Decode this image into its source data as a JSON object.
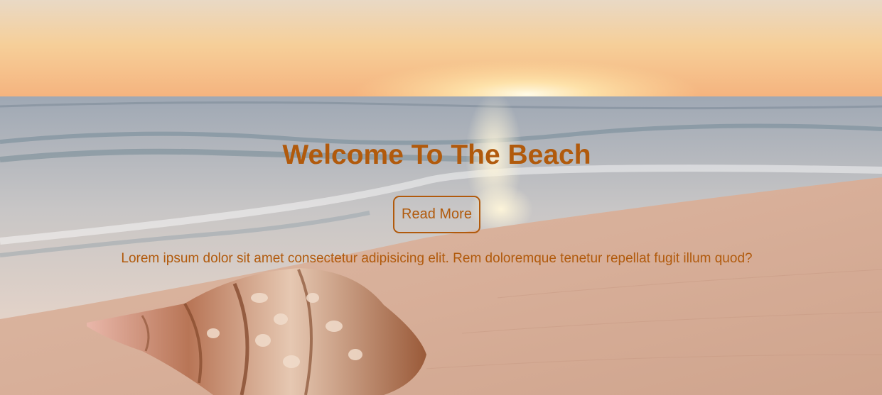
{
  "hero": {
    "title": "Welcome To The Beach",
    "button_label": "Read More",
    "description": "Lorem ipsum dolor sit amet consectetur adipisicing elit. Rem doloremque tenetur repellat fugit illum quod?"
  },
  "colors": {
    "accent": "#b15a0c"
  }
}
